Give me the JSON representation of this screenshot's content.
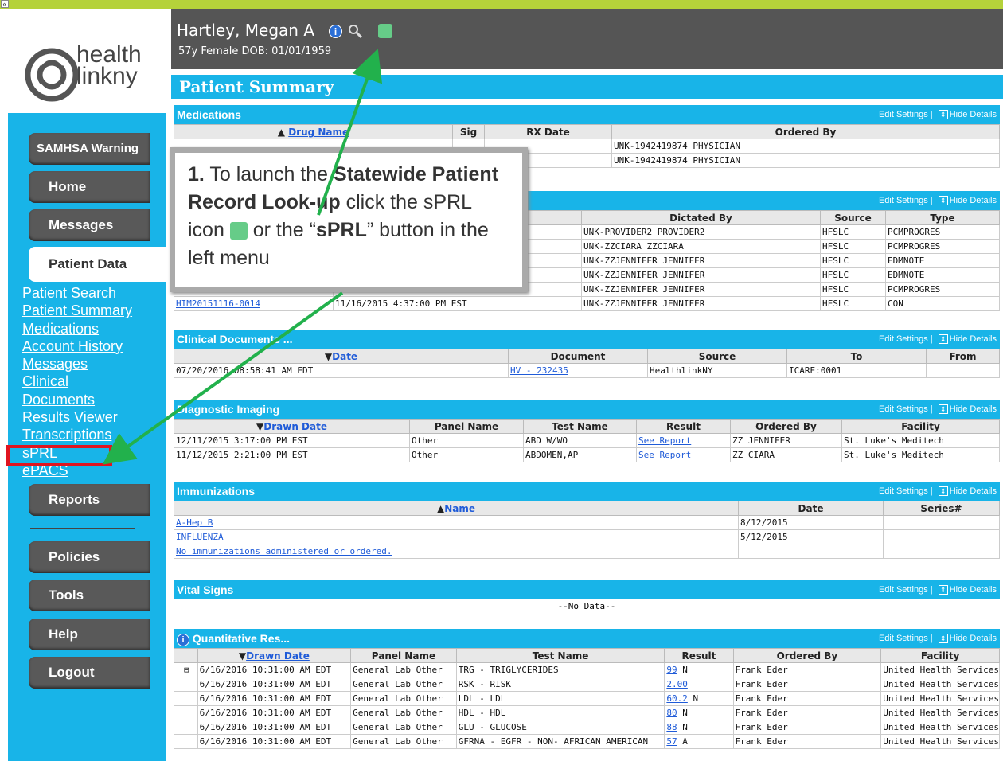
{
  "app": {
    "logo_line1": "health",
    "logo_line2": "linkny",
    "collapse_glyph": "«"
  },
  "patient": {
    "name": "Hartley, Megan A",
    "info": "57y Female  DOB: 01/01/1959"
  },
  "page_title": "Patient  Summary",
  "sidebar": {
    "buttons": [
      "SAMHSA Warning",
      "Home",
      "Messages",
      "Patient Data"
    ],
    "links": [
      "Patient Search",
      "Patient Summary",
      "Medications",
      "Account History",
      "Messages",
      "Clinical",
      "Documents",
      "Results Viewer",
      "Transcriptions",
      "sPRL",
      "ePACS"
    ],
    "bottom_buttons": [
      "Reports",
      "Policies",
      "Tools",
      "Help",
      "Logout"
    ]
  },
  "controls": {
    "edit": "Edit Settings",
    "sep": "|",
    "hide": "Hide Details"
  },
  "medications": {
    "title": "Medications",
    "headers": [
      "Drug Name",
      "Sig",
      "RX Date",
      "Ordered By"
    ],
    "rows": [
      [
        "",
        "",
        "",
        "UNK-1942419874 PHYSICIAN"
      ],
      [
        "",
        "",
        "",
        "UNK-1942419874 PHYSICIAN"
      ]
    ]
  },
  "transcriptions": {
    "headers": [
      "",
      "",
      "Dictated By",
      "Source",
      "Type"
    ],
    "rows": [
      [
        "",
        "",
        "UNK-PROVIDER2 PROVIDER2",
        "HFSLC",
        "PCMPROGRES"
      ],
      [
        "",
        "",
        "UNK-ZZCIARA ZZCIARA",
        "HFSLC",
        "PCMPROGRES"
      ],
      [
        "",
        "",
        "UNK-ZZJENNIFER JENNIFER",
        "HFSLC",
        "EDMNOTE"
      ],
      [
        "",
        "",
        "UNK-ZZJENNIFER JENNIFER",
        "HFSLC",
        "EDMNOTE"
      ],
      [
        "",
        "",
        "UNK-ZZJENNIFER JENNIFER",
        "HFSLC",
        "PCMPROGRES"
      ],
      [
        "HIM20151116-0014",
        "11/16/2015 4:37:00 PM EST",
        "UNK-ZZJENNIFER JENNIFER",
        "HFSLC",
        "CON"
      ]
    ]
  },
  "clinical_docs": {
    "title": "Clinical Documents ...",
    "headers": [
      "Date",
      "Document",
      "Source",
      "To",
      "From"
    ],
    "rows": [
      [
        "07/20/2016 08:58:41 AM EDT",
        "HV - 232435",
        "HealthlinkNY",
        "ICARE:0001",
        ""
      ]
    ]
  },
  "imaging": {
    "title": "Diagnostic Imaging",
    "headers": [
      "Drawn Date",
      "Panel Name",
      "Test Name",
      "Result",
      "Ordered By",
      "Facility"
    ],
    "rows": [
      [
        "12/11/2015 3:17:00 PM EST",
        "Other",
        "ABD W/WO",
        "See Report",
        "ZZ JENNIFER",
        "St. Luke's Meditech"
      ],
      [
        "11/12/2015 2:21:00 PM EST",
        "Other",
        "ABDOMEN,AP",
        "See Report",
        "ZZ CIARA",
        "St. Luke's Meditech"
      ]
    ]
  },
  "immunizations": {
    "title": "Immunizations",
    "headers": [
      "Name",
      "Date",
      "Series#"
    ],
    "rows": [
      [
        "A-Hep B",
        "8/12/2015",
        ""
      ],
      [
        "INFLUENZA",
        "5/12/2015",
        ""
      ],
      [
        "No immunizations administered or ordered.",
        "",
        ""
      ]
    ]
  },
  "vitals": {
    "title": "Vital Signs",
    "empty": "--No Data--"
  },
  "quant": {
    "title": "Quantitative Res...",
    "headers": [
      "",
      "Drawn Date",
      "Panel Name",
      "Test Name",
      "Result",
      "Ordered By",
      "Facility"
    ],
    "rows": [
      [
        "⊟",
        "6/16/2016 10:31:00 AM EDT",
        "General Lab Other",
        "TRG - TRIGLYCERIDES",
        "99",
        "N",
        "Frank Eder",
        "United Health Services"
      ],
      [
        "",
        "6/16/2016 10:31:00 AM EDT",
        "General Lab Other",
        "RSK - RISK",
        "2.00",
        "",
        "Frank Eder",
        "United Health Services"
      ],
      [
        "",
        "6/16/2016 10:31:00 AM EDT",
        "General Lab Other",
        "LDL - LDL",
        "60.2",
        "N",
        "Frank Eder",
        "United Health Services"
      ],
      [
        "",
        "6/16/2016 10:31:00 AM EDT",
        "General Lab Other",
        "HDL - HDL",
        "80",
        "N",
        "Frank Eder",
        "United Health Services"
      ],
      [
        "",
        "6/16/2016 10:31:00 AM EDT",
        "General Lab Other",
        "GLU - GLUCOSE",
        "88",
        "N",
        "Frank Eder",
        "United Health Services"
      ],
      [
        "",
        "6/16/2016 10:31:00 AM EDT",
        "General Lab Other",
        "GFRNA - EGFR - NON- AFRICAN AMERICAN",
        "57",
        "A",
        "Frank Eder",
        "United Health Services"
      ]
    ]
  },
  "callout": {
    "num": "1.",
    "t1": " To launch the ",
    "b1": "Statewide Patient Record Look-up",
    "t2": " click the sPRL icon ",
    "t3": " or the “",
    "b2": "sPRL",
    "t4": "” button in the left menu"
  },
  "colors": {
    "accent": "#18b4e8",
    "topbar": "#b5d23a",
    "header": "#555555",
    "arrow": "#22b14c",
    "highlight": "#e0141f"
  }
}
